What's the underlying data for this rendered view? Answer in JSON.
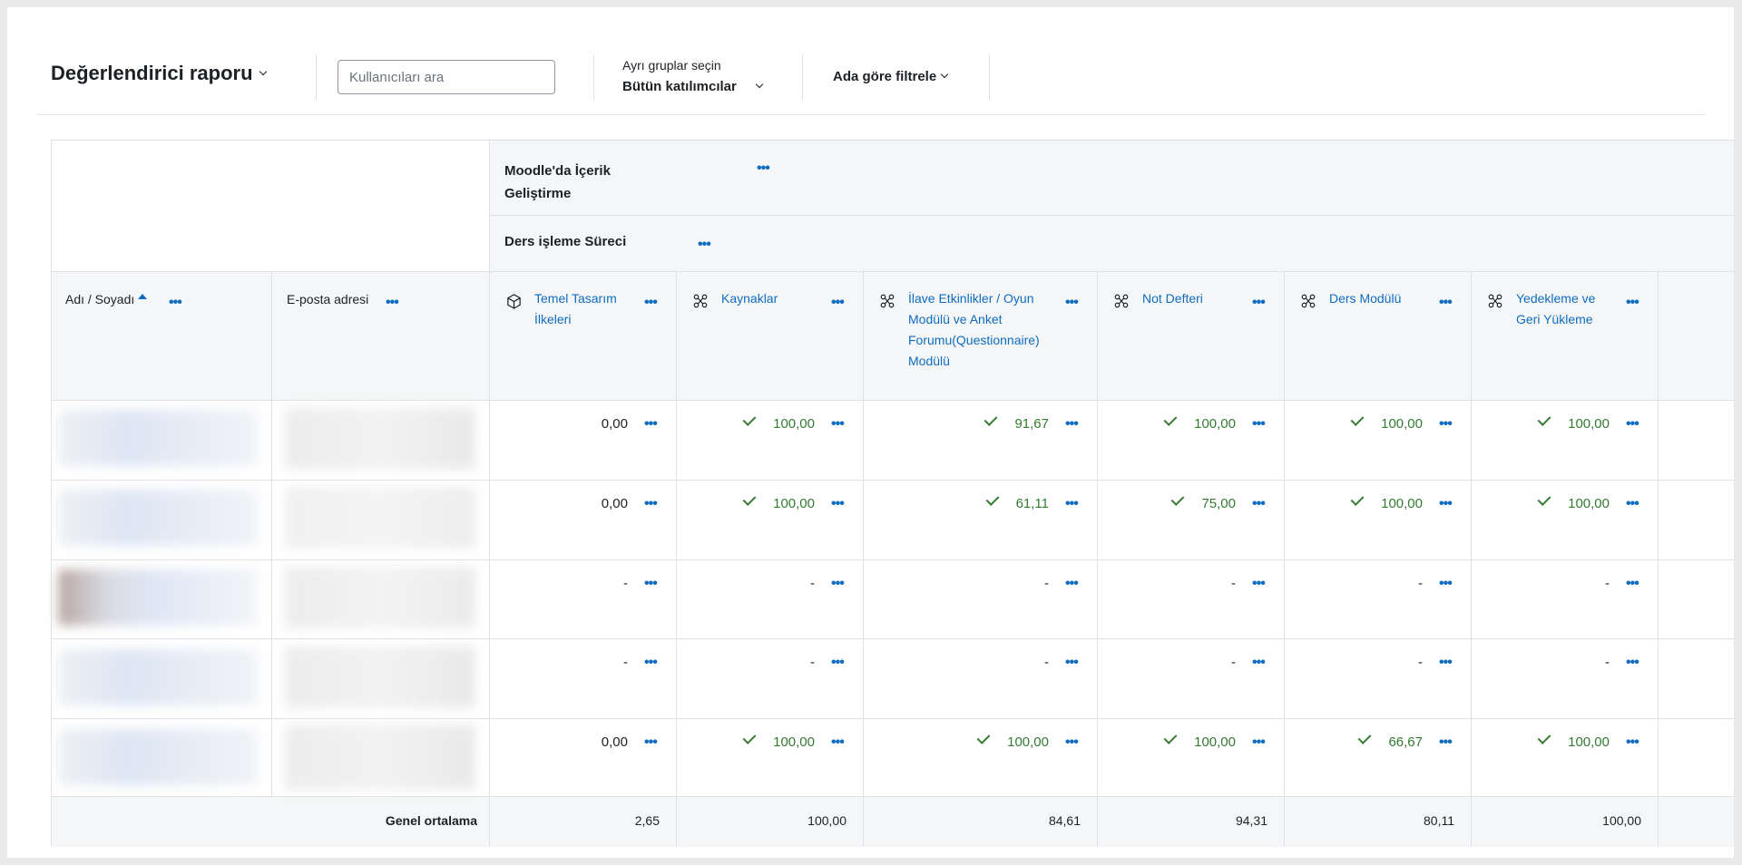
{
  "header": {
    "title": "Değerlendirici raporu",
    "search_placeholder": "Kullanıcıları ara",
    "groups_label": "Ayrı gruplar seçin",
    "groups_value": "Bütün katılımcılar",
    "name_filter": "Ada göre filtrele"
  },
  "categories": {
    "course": "Moodle'da İçerik Geliştirme",
    "sub": "Ders işleme Süreci"
  },
  "columns": {
    "name": "Adı / Soyadı",
    "email": "E-posta adresi",
    "items": [
      {
        "label": "Temel Tasarım İlkeleri",
        "icon": "cube-icon"
      },
      {
        "label": "Kaynaklar",
        "icon": "module-icon"
      },
      {
        "label": "İlave Etkinlikler / Oyun Modülü ve Anket Forumu(Questionnaire) Modülü",
        "icon": "module-icon"
      },
      {
        "label": "Not Defteri",
        "icon": "module-icon"
      },
      {
        "label": "Ders Modülü",
        "icon": "module-icon"
      },
      {
        "label": "Yedekleme ve Geri Yükleme",
        "icon": "module-icon"
      }
    ]
  },
  "rows": [
    {
      "grades": [
        {
          "value": "0,00",
          "check": false
        },
        {
          "value": "100,00",
          "check": true
        },
        {
          "value": "91,67",
          "check": true
        },
        {
          "value": "100,00",
          "check": true
        },
        {
          "value": "100,00",
          "check": true
        },
        {
          "value": "100,00",
          "check": true
        }
      ]
    },
    {
      "grades": [
        {
          "value": "0,00",
          "check": false
        },
        {
          "value": "100,00",
          "check": true
        },
        {
          "value": "61,11",
          "check": true
        },
        {
          "value": "75,00",
          "check": true
        },
        {
          "value": "100,00",
          "check": true
        },
        {
          "value": "100,00",
          "check": true
        }
      ]
    },
    {
      "grades": [
        {
          "value": "-",
          "check": false
        },
        {
          "value": "-",
          "check": false
        },
        {
          "value": "-",
          "check": false
        },
        {
          "value": "-",
          "check": false
        },
        {
          "value": "-",
          "check": false
        },
        {
          "value": "-",
          "check": false
        }
      ]
    },
    {
      "grades": [
        {
          "value": "-",
          "check": false
        },
        {
          "value": "-",
          "check": false
        },
        {
          "value": "-",
          "check": false
        },
        {
          "value": "-",
          "check": false
        },
        {
          "value": "-",
          "check": false
        },
        {
          "value": "-",
          "check": false
        }
      ]
    },
    {
      "grades": [
        {
          "value": "0,00",
          "check": false
        },
        {
          "value": "100,00",
          "check": true
        },
        {
          "value": "100,00",
          "check": true
        },
        {
          "value": "100,00",
          "check": true
        },
        {
          "value": "66,67",
          "check": true
        },
        {
          "value": "100,00",
          "check": true
        }
      ]
    }
  ],
  "footer": {
    "label": "Genel ortalama",
    "averages": [
      "2,65",
      "100,00",
      "84,61",
      "94,31",
      "80,11",
      "100,00"
    ]
  },
  "colors": {
    "link": "#0f6cbf",
    "pass": "#357a32"
  }
}
